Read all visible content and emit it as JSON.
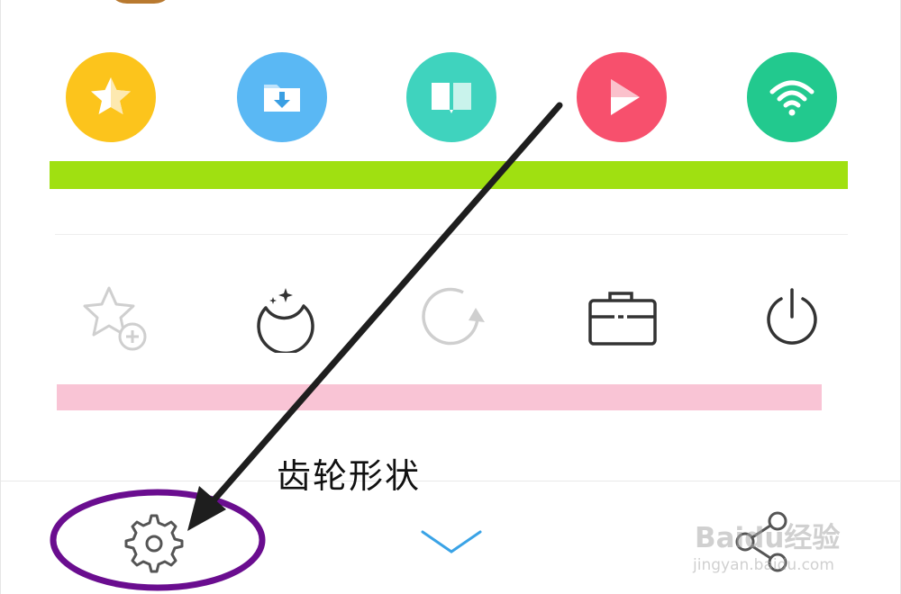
{
  "colors": {
    "favorites": "#fcc41c",
    "downloads": "#5ab8f4",
    "reader": "#3fd3be",
    "video": "#f7506d",
    "wifi": "#22c98e",
    "green_bar": "#a0e011",
    "pink_bar": "#f9c4d5",
    "tool_active": "#333333",
    "tool_disabled": "#cfcfcf",
    "chevron": "#3aa3e6",
    "annotation": "#6a0d8f"
  },
  "quick_actions": [
    {
      "name": "favorites",
      "icon": "star-icon"
    },
    {
      "name": "downloads",
      "icon": "download-folder-icon"
    },
    {
      "name": "reader",
      "icon": "book-icon"
    },
    {
      "name": "video",
      "icon": "play-icon"
    },
    {
      "name": "wifi",
      "icon": "wifi-icon"
    }
  ],
  "tools": [
    {
      "name": "add-bookmark",
      "icon": "star-plus-icon",
      "enabled": false
    },
    {
      "name": "night-mode",
      "icon": "moon-stars-icon",
      "enabled": true
    },
    {
      "name": "refresh",
      "icon": "refresh-icon",
      "enabled": false
    },
    {
      "name": "toolbox",
      "icon": "briefcase-icon",
      "enabled": true
    },
    {
      "name": "exit",
      "icon": "power-icon",
      "enabled": true
    }
  ],
  "bottom_bar": {
    "settings_icon": "gear-icon",
    "collapse_icon": "chevron-down-icon",
    "share_icon": "share-icon"
  },
  "annotation": {
    "label": "齿轮形状"
  },
  "watermark": {
    "text": "Baidu经验",
    "url": "jingyan.baidu.com"
  }
}
